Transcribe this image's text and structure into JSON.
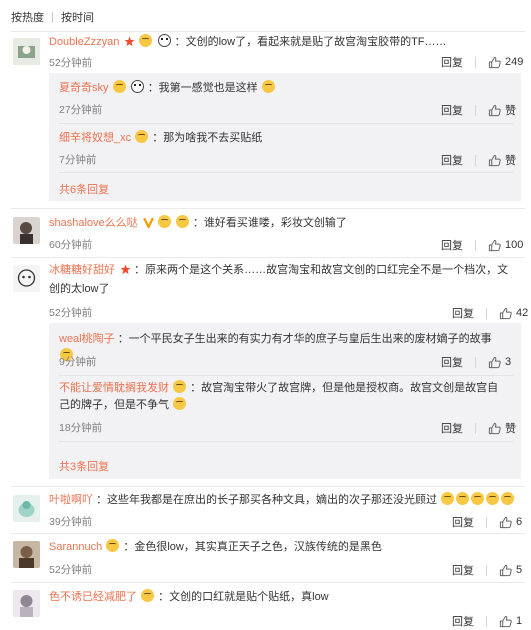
{
  "sort": {
    "hot": "按热度",
    "time": "按时间"
  },
  "labels": {
    "reply": "回复",
    "like": "赞"
  },
  "colors": {
    "name": "#eb7350",
    "sub_bg": "#f2f2f5",
    "time": "#808080"
  },
  "comments": [
    {
      "name": "DoubleZzzyan",
      "text": "：文创的low了，看起来就是贴了故宫淘宝胶带的TF……",
      "time": "52分钟前",
      "likes": "249",
      "replies": [
        {
          "name": "夏奇奇sky",
          "text": "：我第一感觉也是这样",
          "time": "27分钟前"
        },
        {
          "name": "细辛将奴想_xc",
          "text": "：那为啥我不去买贴纸",
          "time": "7分钟前"
        }
      ],
      "more": "共6条回复"
    },
    {
      "name": "shashalove么么哒",
      "text": "：谁好看买谁喽，彩妆文创输了",
      "time": "60分钟前",
      "likes": "100"
    },
    {
      "name": "冰糖糖好甜好",
      "text": "：原来两个是这个关系……故宫淘宝和故宫文创的口红完全不是一个档次，文创的太low了",
      "time": "52分钟前",
      "likes": "42",
      "replies": [
        {
          "name": "weal桃陶子",
          "text": "：一个平民女子生出来的有实力有才华的庶子与皇后生出来的废材嫡子的故事",
          "time": "9分钟前",
          "likes": "3"
        },
        {
          "name": "不能让爱情耽搁我发财",
          "text": "：故宫淘宝带火了故宫牌，但是他是授权商。故宫文创是故宫自己的牌子，但是不争气",
          "time": "18分钟前"
        }
      ],
      "more": "共3条回复"
    },
    {
      "name": "叶啦啊吖",
      "text": "：这些年我都是在庶出的长子那买各种文具，嫡出的次子那还没光顾过",
      "time": "39分钟前",
      "likes": "6"
    },
    {
      "name": "Sarannuch",
      "text": "：金色很low，其实真正天子之色，汉族传统的是黑色",
      "time": "52分钟前",
      "likes": "5"
    },
    {
      "name": "色不诱已经减肥了",
      "text": "：文创的口红就是贴个贴纸，真low",
      "time": "",
      "likes": "1"
    }
  ]
}
